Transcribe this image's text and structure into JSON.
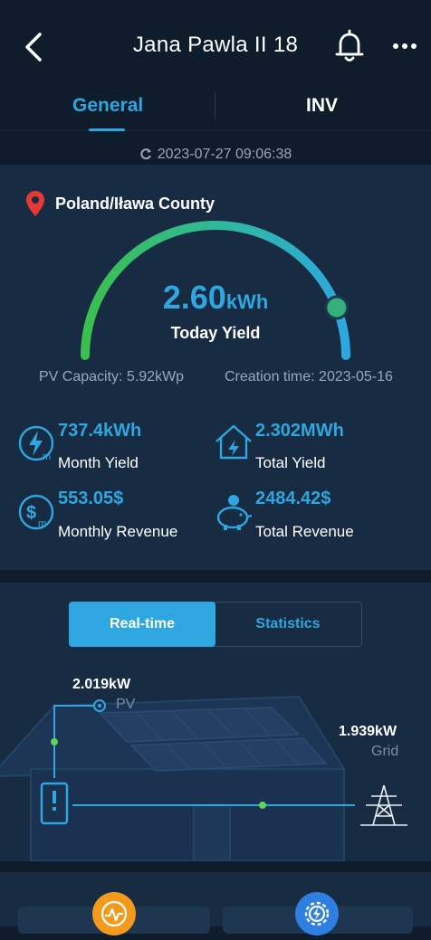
{
  "header": {
    "title": "Jana Pawla II 18"
  },
  "tabs": {
    "general": "General",
    "inv": "INV"
  },
  "refresh": {
    "timestamp": "2023-07-27 09:06:38"
  },
  "overview": {
    "location": "Poland/Iława County",
    "today_yield_value": "2.60",
    "today_yield_unit": "kWh",
    "today_yield_label": "Today Yield",
    "gauge_fraction": 0.88,
    "pv_capacity": "PV Capacity: 5.92kWp",
    "creation_time": "Creation time: 2023-05-16"
  },
  "stats": {
    "month_yield": {
      "value": "737.4kWh",
      "label": "Month Yield"
    },
    "total_yield": {
      "value": "2.302MWh",
      "label": "Total Yield"
    },
    "monthly_revenue": {
      "value": "553.05$",
      "label": "Monthly Revenue"
    },
    "total_revenue": {
      "value": "2484.42$",
      "label": "Total Revenue"
    }
  },
  "flow": {
    "tab_realtime": "Real-time",
    "tab_statistics": "Statistics",
    "pv_value": "2.019kW",
    "pv_label": "PV",
    "grid_value": "1.939kW",
    "grid_label": "Grid"
  },
  "colors": {
    "accent": "#2ea7e0",
    "gauge_green": "#3bbf4d",
    "orange": "#f39a1c",
    "location_red": "#e53935"
  },
  "icons": [
    "back-icon",
    "bell-icon",
    "more-icon",
    "refresh-icon",
    "location-pin-icon",
    "energy-meter-icon",
    "house-bolt-icon",
    "money-icon",
    "piggy-bank-icon",
    "inverter-icon",
    "power-tower-icon",
    "performance-icon",
    "settings-icon"
  ]
}
